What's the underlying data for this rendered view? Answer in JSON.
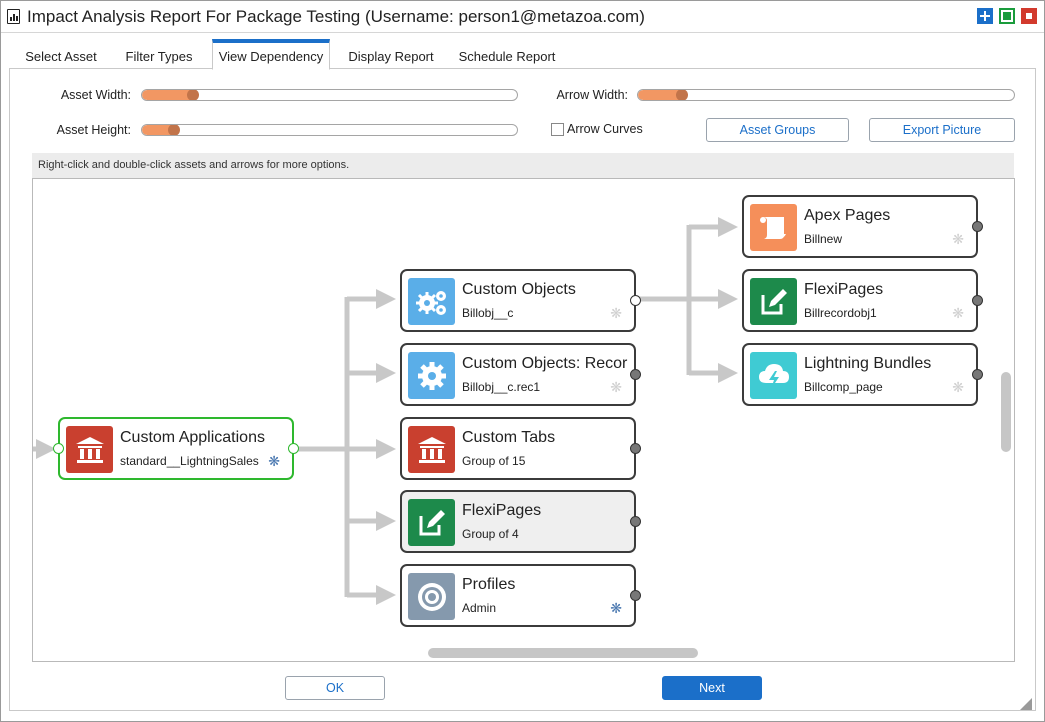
{
  "window": {
    "title": "Impact Analysis Report For Package Testing (Username: person1@metazoa.com)"
  },
  "tabs": [
    {
      "label": "Select Asset"
    },
    {
      "label": "Filter Types"
    },
    {
      "label": "View Dependency",
      "active": true
    },
    {
      "label": "Display Report"
    },
    {
      "label": "Schedule Report"
    }
  ],
  "controls": {
    "asset_width": {
      "label": "Asset Width:",
      "value": 0.12
    },
    "asset_height": {
      "label": "Asset Height:",
      "value": 0.07
    },
    "arrow_width": {
      "label": "Arrow Width:",
      "value": 0.1
    },
    "arrow_curves": {
      "label": "Arrow Curves",
      "checked": false
    },
    "asset_groups_label": "Asset Groups",
    "export_picture_label": "Export Picture"
  },
  "hint": "Right-click and double-click assets and arrows for more options.",
  "nodes": [
    {
      "title": "Custom Applications",
      "subtitle": "standard__LightningSales",
      "icon": "bank-icon",
      "color": "#c9402f",
      "star": "blue"
    },
    {
      "title": "Custom Objects",
      "subtitle": "Billobj__c",
      "icon": "gears-icon",
      "color": "#5aaee8",
      "star": "grey"
    },
    {
      "title": "Custom Objects: Record Types",
      "subtitle": "Billobj__c.rec1",
      "icon": "gear-icon",
      "color": "#5aaee8",
      "star": "grey"
    },
    {
      "title": "Custom Tabs",
      "subtitle": "Group of 15",
      "icon": "bank-icon",
      "color": "#c9402f",
      "star": "none"
    },
    {
      "title": "FlexiPages",
      "subtitle": "Group of 4",
      "icon": "edit-icon",
      "color": "#1d8a4b",
      "star": "none"
    },
    {
      "title": "Profiles",
      "subtitle": "Admin",
      "icon": "target-icon",
      "color": "#8599ad",
      "star": "blue"
    },
    {
      "title": "Apex Pages",
      "subtitle": "Billnew",
      "icon": "scroll-icon",
      "color": "#f58f5a",
      "star": "grey"
    },
    {
      "title": "FlexiPages",
      "subtitle": "Billrecordobj1",
      "icon": "edit-icon",
      "color": "#1d8a4b",
      "star": "grey"
    },
    {
      "title": "Lightning Bundles",
      "subtitle": "Billcomp_page",
      "icon": "cloud-bolt-icon",
      "color": "#3fcbd3",
      "star": "grey"
    }
  ],
  "footer": {
    "ok_label": "OK",
    "next_label": "Next"
  },
  "colors": {
    "accent": "#1b6fc9",
    "slider_fill": "#f29763",
    "arrow": "#c8c8c8",
    "selected_border": "#2eb82e"
  }
}
